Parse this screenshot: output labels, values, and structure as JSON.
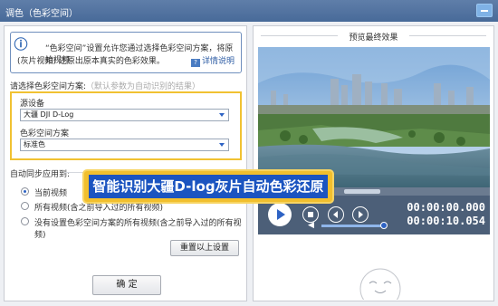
{
  "window": {
    "title": "调色（色彩空间）"
  },
  "notice": {
    "line1": "“色彩空间”设置允许您通过选择色彩空间方案，将原始视频",
    "line2": "(灰片视频) 还原出原本真实的色彩效果。",
    "help_link": "详情说明"
  },
  "scheme": {
    "heading": "请选择色彩空间方案:",
    "hint": "（默认参数为自动识别的结果）",
    "source_label": "源设备",
    "source_value": "大疆 DJI D-Log",
    "colorspace_label": "色彩空间方案",
    "colorspace_value": "标准色"
  },
  "sync": {
    "heading": "自动同步应用到:",
    "options": [
      "当前视频",
      "所有视频(含之前导入过的所有视频)",
      "没有设置色彩空间方案的所有视频(含之前导入过的所有视频)"
    ],
    "selected_index": 0,
    "reset_label": "重置以上设置"
  },
  "confirm_label": "确 定",
  "preview": {
    "title": "预览最终效果",
    "time_current": "00:00:00.000",
    "time_total": "00:00:10.054"
  },
  "banner_text": "智能识别大疆D-log灰片自动色彩还原",
  "colors": {
    "accent": "#1b54c0",
    "highlight": "#f1c232",
    "titlebar": "#486a99"
  }
}
